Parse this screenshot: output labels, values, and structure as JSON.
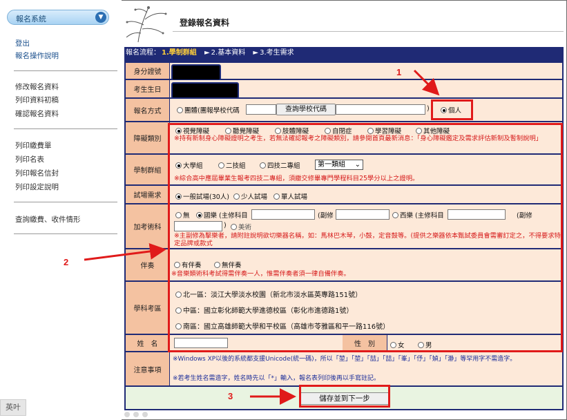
{
  "sidebar": {
    "system_name": "報名系統",
    "links_top": [
      "登出",
      "報名操作說明"
    ],
    "links_mid": [
      "修改報名資料",
      "列印資料初稿",
      "確認報名資料"
    ],
    "links_bottom": [
      "列印繳費單",
      "列印名表",
      "列印報名信封",
      "列印設定說明"
    ],
    "links_last": [
      "查詢繳費、收件情形"
    ],
    "lang_button": "英叶"
  },
  "header": {
    "page_title": "登錄報名資料"
  },
  "flow": {
    "prefix": "報名流程：",
    "step1": "1.學制群組",
    "step2": "2.基本資料",
    "step3": "3.考生需求"
  },
  "form": {
    "id_label": "身分證號",
    "birth_label": "考生生日",
    "method_label": "報名方式",
    "method_group": "團體(團報學校代碼",
    "method_query_button": "查詢學校代碼",
    "method_close": ")",
    "method_individual": "個人",
    "disability_label": "障礙類別",
    "disability_options": [
      "視覺障礙",
      "聽覺障礙",
      "肢體障礙",
      "自閉症",
      "學習障礙",
      "其他障礙"
    ],
    "disability_note": "※持有新制身心障礙證明之考生，若無法確認報考之障礙類別，請參閱首頁最新消息：「身心障礙鑑定及需求評估新制及暫制說明」",
    "group_label": "學制群組",
    "group_options": [
      "大學組",
      "二技組",
      "四技二專組"
    ],
    "group_select": "第一類組",
    "group_note": "※綜合高中應屆畢業生報考四技二專組，須繳交修畢專門學程科目25學分以上之證明。",
    "exam_label": "試場需求",
    "exam_options": [
      "一般試場(30人)",
      "少人試場",
      "單人試場"
    ],
    "art_label": "加考術科",
    "art_options": [
      "無",
      "國樂 (主修科目",
      "西樂 (主修科目",
      "美術"
    ],
    "art_minor1": "(副修",
    "art_minor2": "(副修",
    "art_close": ")",
    "art_note": "※主副修為擊樂者，請附註說明欲切樂器名稱，如：馬林巴木琴，小鼓，定音鼓等。(提供之樂器依本甄試委員會需審訂定之，不得要求特定品牌或款式",
    "accomp_label": "伴奏",
    "accomp_options": [
      "有伴奏",
      "無伴奏"
    ],
    "accomp_note": "※音樂類術科考試得需伴奏一人，惟需伴奏者須一律自備伴奏。",
    "region_label": "學科考區",
    "region_options": [
      "北一區：淡江大學淡水校園（新北市淡水區英專路151號）",
      "中區：國立彰化師範大學進德校區（彰化市進德路1號）",
      "南區：國立高雄師範大學和平校區（高雄市苓雅區和平一路116號）"
    ],
    "name_label": "姓　名",
    "gender_label": "性　別",
    "gender_options": [
      "女",
      "男"
    ],
    "notes_label": "注意事項",
    "notes_line1": "※Windows XP以後的系統都支援Unicode(統一碼)，所以「堃」「堃」「喆」「喆」「峯」「伃」「媜」「瀞」等罕用字不需造字。",
    "notes_line2": "※若考生姓名需造字，姓名時先以「*」輸入，報名表列印後再以手寫註記。",
    "submit_button": "儲存並到下一步"
  },
  "annotations": [
    "1",
    "2",
    "3"
  ],
  "colors": {
    "header_navy": "#1f2a75",
    "label_bg": "#f4c2a1",
    "cell_bg": "#fde9d9",
    "highlight_red": "#e01a1a",
    "note_red": "#d61a1a",
    "current_step": "#ffcf3a"
  }
}
